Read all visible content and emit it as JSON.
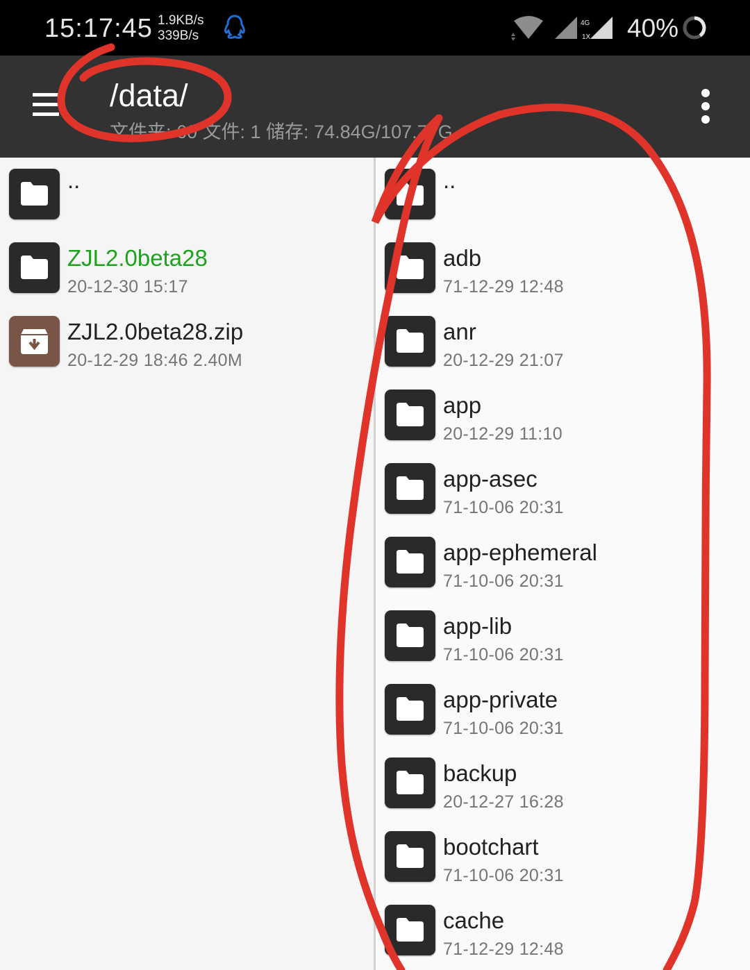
{
  "status_bar": {
    "time": "15:17:45",
    "net_down": "1.9KB/s",
    "net_up": "339B/s",
    "net_type": "4G",
    "sim_label": "1X",
    "battery": "40%",
    "icons": [
      "qq-icon",
      "wifi-icon",
      "signal-icon",
      "signal-4g-icon",
      "battery-icon"
    ]
  },
  "toolbar": {
    "path": "/data/",
    "subtitle": "文件夹: 60  文件: 1  储存: 74.84G/107.77G",
    "menu_icon": "hamburger-menu-icon",
    "overflow_icon": "more-vert-icon"
  },
  "left_pane": {
    "items": [
      {
        "name": "..",
        "meta": "",
        "type": "folder"
      },
      {
        "name": "ZJL2.0beta28",
        "meta": "20-12-30 15:17",
        "type": "folder",
        "highlight_color": "#1ca21c"
      },
      {
        "name": "ZJL2.0beta28.zip",
        "meta": "20-12-29 18:46  2.40M",
        "type": "archive"
      }
    ]
  },
  "right_pane": {
    "items": [
      {
        "name": "..",
        "meta": "",
        "type": "folder"
      },
      {
        "name": "adb",
        "meta": "71-12-29 12:48",
        "type": "folder"
      },
      {
        "name": "anr",
        "meta": "20-12-29 21:07",
        "type": "folder"
      },
      {
        "name": "app",
        "meta": "20-12-29 11:10",
        "type": "folder"
      },
      {
        "name": "app-asec",
        "meta": "71-10-06 20:31",
        "type": "folder"
      },
      {
        "name": "app-ephemeral",
        "meta": "71-10-06 20:31",
        "type": "folder"
      },
      {
        "name": "app-lib",
        "meta": "71-10-06 20:31",
        "type": "folder"
      },
      {
        "name": "app-private",
        "meta": "71-10-06 20:31",
        "type": "folder"
      },
      {
        "name": "backup",
        "meta": "20-12-27 16:28",
        "type": "folder"
      },
      {
        "name": "bootchart",
        "meta": "71-10-06 20:31",
        "type": "folder"
      },
      {
        "name": "cache",
        "meta": "71-12-29 12:48",
        "type": "folder"
      }
    ]
  },
  "colors": {
    "toolbar_bg": "#323232",
    "status_bg": "#000000",
    "accent_green": "#1ca21c",
    "zip_icon_bg": "#795548",
    "annotation_red": "#e0342b"
  }
}
